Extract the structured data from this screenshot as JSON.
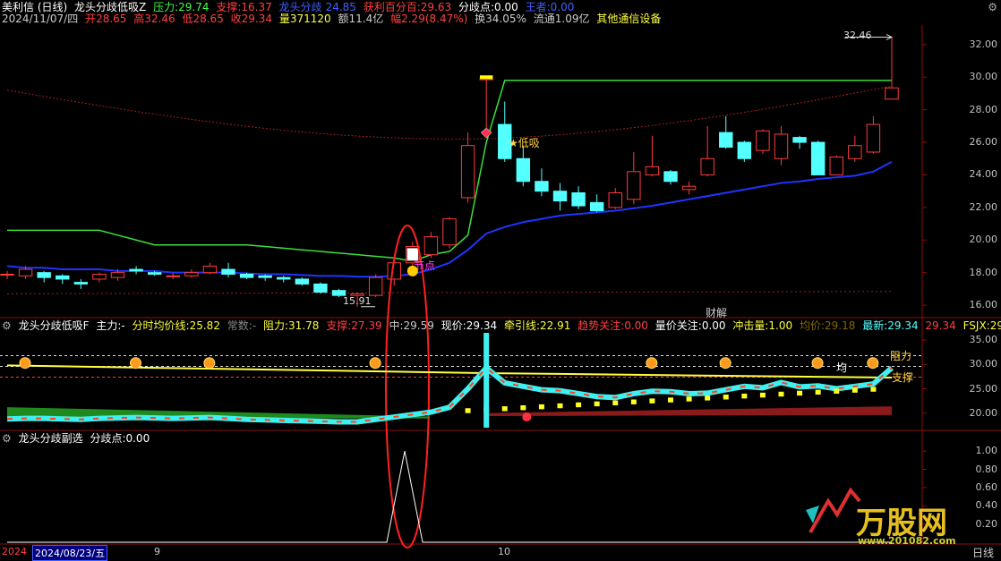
{
  "main": {
    "title": "美利信 (日线)",
    "indicator_name": "龙头分歧低吸Z",
    "pressure_label": "压力:",
    "pressure": "29.74",
    "support_label": "支撑:",
    "support": "16.37",
    "divergence_label": "龙头分歧",
    "divergence": "24.85",
    "profit_pct_label": "获利百分百:",
    "profit_pct": "29.63",
    "div_point_label": "分歧点:",
    "div_point": "0.00",
    "king_label": "王者:",
    "king": "0.00",
    "date": "2024/11/07/四",
    "open_label": "开",
    "open": "28.65",
    "high_label": "高",
    "high": "32.46",
    "low_label": "低",
    "low": "28.65",
    "close_label": "收",
    "close": "29.34",
    "vol_label": "量",
    "vol": "371120",
    "amount_label": "额",
    "amount": "11.4亿",
    "amp_label": "幅",
    "amp": "2.29(8.47%)",
    "turnover_label": "换",
    "turnover": "34.05%",
    "float_label": "流通",
    "float_cap": "1.09亿",
    "sector": "其他通信设备",
    "high_marker": "32.46",
    "low_marker": "15.91",
    "ann_buy": "低吸",
    "ann_node": "节点",
    "ann_finance": "财解",
    "y_ticks": [
      "32.00",
      "30.00",
      "28.00",
      "26.00",
      "24.00",
      "22.00",
      "20.00",
      "18.00",
      "16.00"
    ]
  },
  "mid": {
    "name": "龙头分歧低吸F",
    "main_label": "主力:",
    "main_val": "-",
    "avg_label": "分时均价线:",
    "avg": "25.82",
    "const_label": "常数:",
    "const_val": "-",
    "resist_label": "阻力:",
    "resist": "31.78",
    "support_label": "支撑:",
    "support": "27.39",
    "mid_label": "中:",
    "mid_val": "29.59",
    "now_label": "现价:",
    "now": "29.34",
    "traction_label": "牵引线:",
    "traction": "22.91",
    "trend_label": "趋势关注:",
    "trend": "0.00",
    "vp_label": "量价关注:",
    "vp": "0.00",
    "impact_label": "冲击量:",
    "impact": "1.00",
    "avgp_label": "均价:",
    "avgp": "29.18",
    "latest_label": "最新:",
    "latest": "29.34",
    "latest2": "29.34",
    "fsjx_label": "FSJX:",
    "fsjx": "29",
    "ann_resist": "阻力",
    "ann_avg": "均",
    "ann_support": "支撑",
    "y_ticks": [
      "35.00",
      "30.00",
      "25.00",
      "20.00"
    ]
  },
  "sub": {
    "name": "龙头分歧副选",
    "div_label": "分歧点:",
    "div_val": "0.00",
    "y_ticks": [
      "1.00",
      "0.80",
      "0.60",
      "0.40",
      "0.20"
    ]
  },
  "bottom": {
    "date_prefix": "2024",
    "date_box": "2024/08/23/五",
    "month_9": "9",
    "month_10": "10",
    "period": "日线"
  },
  "watermark": {
    "brand": "万股网",
    "url": "www.201082.com"
  },
  "chart_data": {
    "type": "candlestick",
    "title": "美利信 (日线)",
    "ylim": [
      15.4,
      33.2
    ],
    "candles": [
      {
        "o": 17.9,
        "c": 17.9,
        "h": 18.1,
        "l": 17.6
      },
      {
        "o": 17.8,
        "c": 18.2,
        "h": 18.4,
        "l": 17.6
      },
      {
        "o": 18.0,
        "c": 17.7,
        "h": 18.1,
        "l": 17.4
      },
      {
        "o": 17.8,
        "c": 17.6,
        "h": 17.9,
        "l": 17.3
      },
      {
        "o": 17.4,
        "c": 17.3,
        "h": 17.6,
        "l": 17.0
      },
      {
        "o": 17.6,
        "c": 17.9,
        "h": 18.0,
        "l": 17.4
      },
      {
        "o": 17.7,
        "c": 18.0,
        "h": 18.2,
        "l": 17.5
      },
      {
        "o": 18.2,
        "c": 18.1,
        "h": 18.4,
        "l": 17.9
      },
      {
        "o": 18.0,
        "c": 17.9,
        "h": 18.1,
        "l": 17.8
      },
      {
        "o": 17.8,
        "c": 17.8,
        "h": 18.0,
        "l": 17.6
      },
      {
        "o": 17.8,
        "c": 18.0,
        "h": 18.2,
        "l": 17.7
      },
      {
        "o": 18.0,
        "c": 18.4,
        "h": 18.6,
        "l": 17.9
      },
      {
        "o": 18.2,
        "c": 17.9,
        "h": 18.6,
        "l": 17.7
      },
      {
        "o": 17.9,
        "c": 17.7,
        "h": 18.0,
        "l": 17.6
      },
      {
        "o": 17.8,
        "c": 17.7,
        "h": 17.9,
        "l": 17.5
      },
      {
        "o": 17.7,
        "c": 17.6,
        "h": 17.8,
        "l": 17.4
      },
      {
        "o": 17.6,
        "c": 17.3,
        "h": 17.7,
        "l": 17.2
      },
      {
        "o": 17.3,
        "c": 16.8,
        "h": 17.4,
        "l": 16.7
      },
      {
        "o": 16.9,
        "c": 16.6,
        "h": 17.0,
        "l": 16.5
      },
      {
        "o": 16.6,
        "c": 16.7,
        "h": 16.8,
        "l": 15.9
      },
      {
        "o": 16.6,
        "c": 17.7,
        "h": 17.9,
        "l": 16.5
      },
      {
        "o": 17.6,
        "c": 18.6,
        "h": 18.9,
        "l": 17.2
      },
      {
        "o": 18.6,
        "c": 19.6,
        "h": 19.9,
        "l": 18.3
      },
      {
        "o": 19.1,
        "c": 20.2,
        "h": 20.5,
        "l": 18.9
      },
      {
        "o": 19.7,
        "c": 21.3,
        "h": 21.4,
        "l": 19.5
      },
      {
        "o": 22.6,
        "c": 25.8,
        "h": 26.6,
        "l": 22.3
      },
      {
        "o": 29.9,
        "c": 29.9,
        "h": 30.0,
        "l": 26.7
      },
      {
        "o": 27.1,
        "c": 25.0,
        "h": 28.5,
        "l": 24.8
      },
      {
        "o": 25.0,
        "c": 23.6,
        "h": 25.8,
        "l": 23.3
      },
      {
        "o": 23.6,
        "c": 23.0,
        "h": 24.4,
        "l": 22.7
      },
      {
        "o": 23.0,
        "c": 22.4,
        "h": 23.5,
        "l": 21.8
      },
      {
        "o": 22.9,
        "c": 22.1,
        "h": 23.3,
        "l": 21.9
      },
      {
        "o": 22.3,
        "c": 21.8,
        "h": 22.8,
        "l": 21.7
      },
      {
        "o": 22.0,
        "c": 22.9,
        "h": 23.2,
        "l": 21.9
      },
      {
        "o": 22.5,
        "c": 24.2,
        "h": 25.4,
        "l": 22.2
      },
      {
        "o": 24.0,
        "c": 24.5,
        "h": 26.4,
        "l": 23.9
      },
      {
        "o": 24.2,
        "c": 23.6,
        "h": 24.3,
        "l": 23.4
      },
      {
        "o": 23.1,
        "c": 23.3,
        "h": 23.6,
        "l": 22.8
      },
      {
        "o": 24.0,
        "c": 25.0,
        "h": 27.0,
        "l": 23.9
      },
      {
        "o": 26.6,
        "c": 25.7,
        "h": 27.6,
        "l": 25.6
      },
      {
        "o": 26.0,
        "c": 25.0,
        "h": 26.1,
        "l": 24.8
      },
      {
        "o": 25.5,
        "c": 26.7,
        "h": 26.8,
        "l": 25.3
      },
      {
        "o": 25.0,
        "c": 26.5,
        "h": 27.0,
        "l": 24.6
      },
      {
        "o": 26.3,
        "c": 26.0,
        "h": 26.4,
        "l": 25.6
      },
      {
        "o": 26.0,
        "c": 24.0,
        "h": 26.1,
        "l": 24.0
      },
      {
        "o": 24.0,
        "c": 25.1,
        "h": 25.2,
        "l": 24.0
      },
      {
        "o": 25.0,
        "c": 25.8,
        "h": 26.4,
        "l": 24.8
      },
      {
        "o": 25.4,
        "c": 27.1,
        "h": 27.6,
        "l": 25.3
      },
      {
        "o": 28.65,
        "c": 29.34,
        "h": 32.46,
        "l": 28.65
      }
    ]
  },
  "colors": {
    "up": "#ff3b3b",
    "down": "#54ffff",
    "ma_blue": "#1f34ff",
    "ma_green": "#3be03b",
    "label_red": "#ff4040",
    "label_yellow": "#ffff40",
    "label_green": "#40ff40",
    "label_blue": "#4060ff",
    "label_magenta": "#ff40ff"
  }
}
